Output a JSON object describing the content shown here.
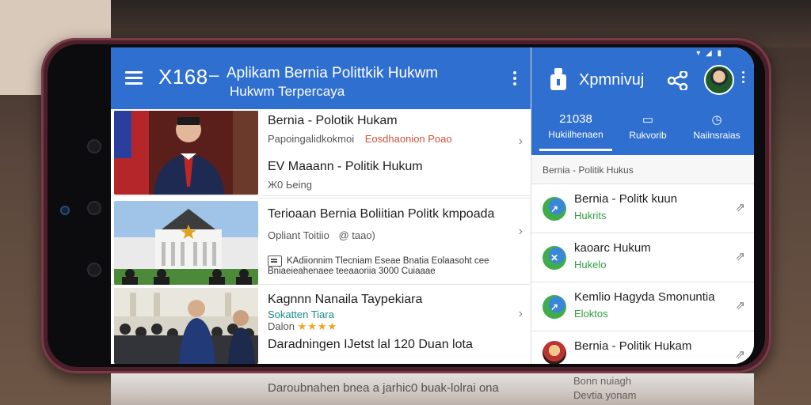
{
  "app": {
    "brand": "X168",
    "separator": "–",
    "title_line1": "Aplikam Bernia Polittkik Hukwm",
    "title_line2": "Hukwm Terpercaya"
  },
  "news": [
    {
      "headline": "Bernia - Polotik Hukam",
      "meta_gray": "Papoingalidkokmoi",
      "meta_red": "Eosdhaonion Poao",
      "thumb": "politician-portrait"
    },
    {
      "headline": "EV Maaann - Politik Hukum",
      "meta_gray": "Ж0 Ьeing",
      "thumb": "none"
    },
    {
      "headline": "Terioaan Bernia Boliitian Politk kmpoada",
      "meta_gray": "Opliant Toitiio",
      "meta_tag": "@ taao)",
      "desc_line1": "KAdiionnim Tlecniam Eseae Bnatia Eolaasoht cee",
      "desc_line2": "Bniaeieahenaee teeaaoriia 3000 Cuiaaae",
      "thumb": "government-building"
    },
    {
      "headline": "Kagnnn Nanaila Taypekiara",
      "meta_teal": "Sokatten Tiara",
      "meta_gray2": "Dalon",
      "rating": "★★★★",
      "footer": "Daradningen IJetst lal 120 Duan lota",
      "thumb": "press-conference"
    }
  ],
  "right": {
    "status": "▾ ◢ ▮",
    "title": "Xpmnivuj",
    "tabs": [
      {
        "icon": "21038",
        "label": "Hukiilhenaen"
      },
      {
        "icon": "▭",
        "label": "Rukvorib"
      },
      {
        "icon": "◷",
        "label": "Naiinsraias"
      }
    ],
    "section": "Bernia - Politik Hukus",
    "items": [
      {
        "title": "Bernia - Politk kuun",
        "sub": "Hukrits"
      },
      {
        "title": "kaoarc Hukum",
        "sub": "Hukelo"
      },
      {
        "title": "Kemlio Hagyda Smonuntia",
        "sub": "Eloktos"
      },
      {
        "title": "Bernia - Politik Hukam",
        "sub": ""
      }
    ]
  },
  "reflection": {
    "left": "Daroubnahen bnea a jarhic0 buak-lolrai ona",
    "right1": "Bonn nuiagh",
    "right2": "Devtia yonam"
  },
  "colors": {
    "primary": "#2f6fd0",
    "accent_red": "#d0523a",
    "accent_green": "#2e9e42",
    "star": "#f2a31b"
  }
}
